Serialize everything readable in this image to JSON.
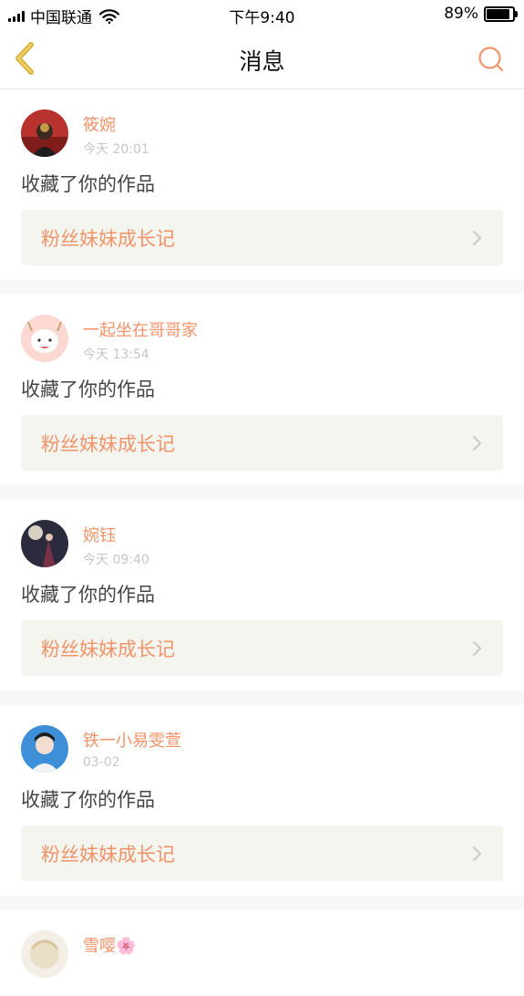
{
  "status_bar": {
    "carrier": "中国联通",
    "time": "下午9:40",
    "battery": "89%",
    "battery_level": 0.89
  },
  "nav": {
    "title": "消息",
    "back_icon": "chevron-left-icon",
    "search_icon": "search-icon",
    "accent": "#f0936a"
  },
  "messages": [
    {
      "user": "筱婉",
      "time": "今天 20:01",
      "action": "收藏了你的作品",
      "target": "粉丝妹妹成长记"
    },
    {
      "user": "一起坐在哥哥家",
      "time": "今天 13:54",
      "action": "收藏了你的作品",
      "target": "粉丝妹妹成长记"
    },
    {
      "user": "婉钰",
      "time": "今天 09:40",
      "action": "收藏了你的作品",
      "target": "粉丝妹妹成长记"
    },
    {
      "user": "铁一小易雯萱",
      "time": "03-02",
      "action": "收藏了你的作品",
      "target": "粉丝妹妹成长记"
    },
    {
      "user": "雪嘤🌸",
      "time": "",
      "action": "",
      "target": ""
    }
  ]
}
